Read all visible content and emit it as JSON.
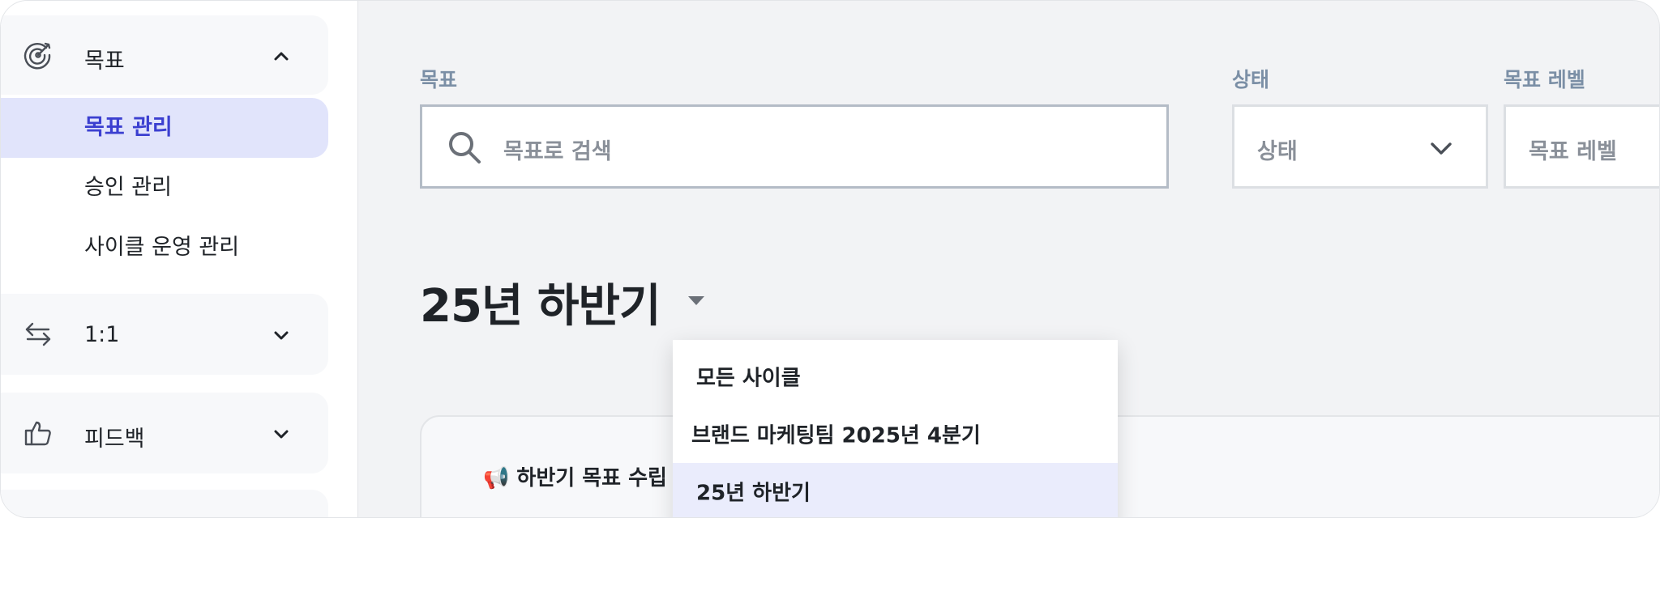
{
  "sidebar": {
    "goal_group": {
      "label": "목표",
      "icon": "target-icon"
    },
    "goal_items": [
      {
        "label": "목표 관리",
        "active": true
      },
      {
        "label": "승인 관리",
        "active": false
      },
      {
        "label": "사이클 운영 관리",
        "active": false
      }
    ],
    "one_on_one_group": {
      "label": "1:1",
      "icon": "exchange-arrows-icon"
    },
    "feedback_group": {
      "label": "피드백",
      "icon": "thumbs-up-icon"
    }
  },
  "filters": {
    "goal_label": "목표",
    "search_placeholder": "목표로 검색",
    "status_label": "상태",
    "status_value": "상태",
    "level_label": "목표 레벨",
    "level_value": "목표 레벨"
  },
  "cycle": {
    "title": "25년 하반기"
  },
  "card": {
    "title": "📢 하반기 목표 수립 가"
  },
  "dropdown": {
    "options": [
      {
        "label": "모든 사이클",
        "selected": false
      },
      {
        "label": "브랜드 마케팅팀 2025년 4분기",
        "selected": false
      },
      {
        "label": "25년 하반기",
        "selected": true
      }
    ]
  },
  "colors": {
    "accent": "#3b3fd0",
    "active_bg": "#e1e4fb",
    "label": "#7b8fa6"
  }
}
